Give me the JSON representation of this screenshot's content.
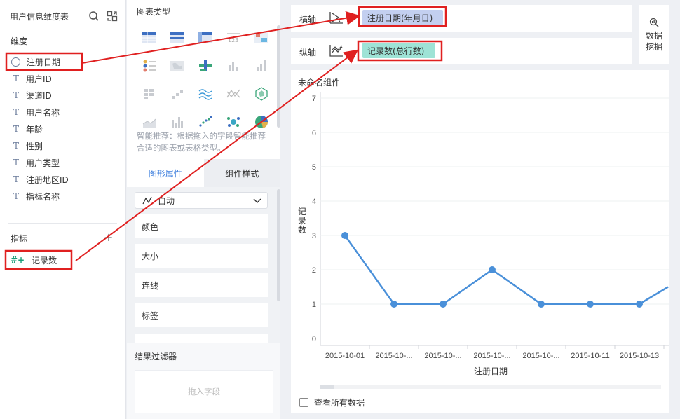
{
  "left_panel": {
    "title": "用户信息维度表",
    "dimension_title": "维度",
    "dimensions": [
      {
        "label": "注册日期",
        "type": "date"
      },
      {
        "label": "用户ID",
        "type": "text"
      },
      {
        "label": "渠道ID",
        "type": "text"
      },
      {
        "label": "用户名称",
        "type": "text"
      },
      {
        "label": "年龄",
        "type": "text"
      },
      {
        "label": "性别",
        "type": "text"
      },
      {
        "label": "用户类型",
        "type": "text"
      },
      {
        "label": "注册地区ID",
        "type": "text"
      },
      {
        "label": "指标名称",
        "type": "text"
      }
    ],
    "text_type_glyph": "T",
    "measure_title": "指标",
    "add_glyph": "+",
    "measure_glyph": "#+",
    "measure": "记录数"
  },
  "middle_panel": {
    "title": "图表类型",
    "hint": "智能推荐：根据拖入的字段智能推荐合适的图表或表格类型。",
    "tabs": {
      "graph_props": "图形属性",
      "component_style": "组件样式"
    },
    "select_value": "自动",
    "properties": [
      "颜色",
      "大小",
      "连线",
      "标签"
    ],
    "filter_title": "结果过滤器",
    "drop_placeholder": "拖入字段"
  },
  "axes": {
    "x_label": "横轴",
    "x_field": "注册日期(年月日)",
    "y_label": "纵轴",
    "y_field": "记录数(总行数)"
  },
  "data_mining": {
    "label": "数据挖掘"
  },
  "chart_card": {
    "title": "未命名组件",
    "show_all_label": "查看所有数据"
  },
  "chart_data": {
    "type": "line",
    "categories": [
      "2015-10-01",
      "2015-10-...",
      "2015-10-...",
      "2015-10-...",
      "2015-10-...",
      "2015-10-11",
      "2015-10-13"
    ],
    "values": [
      3,
      1,
      1,
      2,
      1,
      1,
      1
    ],
    "trailing_partial_value": 1.5,
    "xlabel": "注册日期",
    "ylabel": "记录数",
    "ylim": [
      0,
      7
    ],
    "yticks": [
      0,
      1,
      2,
      3,
      4,
      5,
      6,
      7
    ],
    "grid": true,
    "color": "#4a90d9"
  },
  "annotation_color": "#e02020"
}
